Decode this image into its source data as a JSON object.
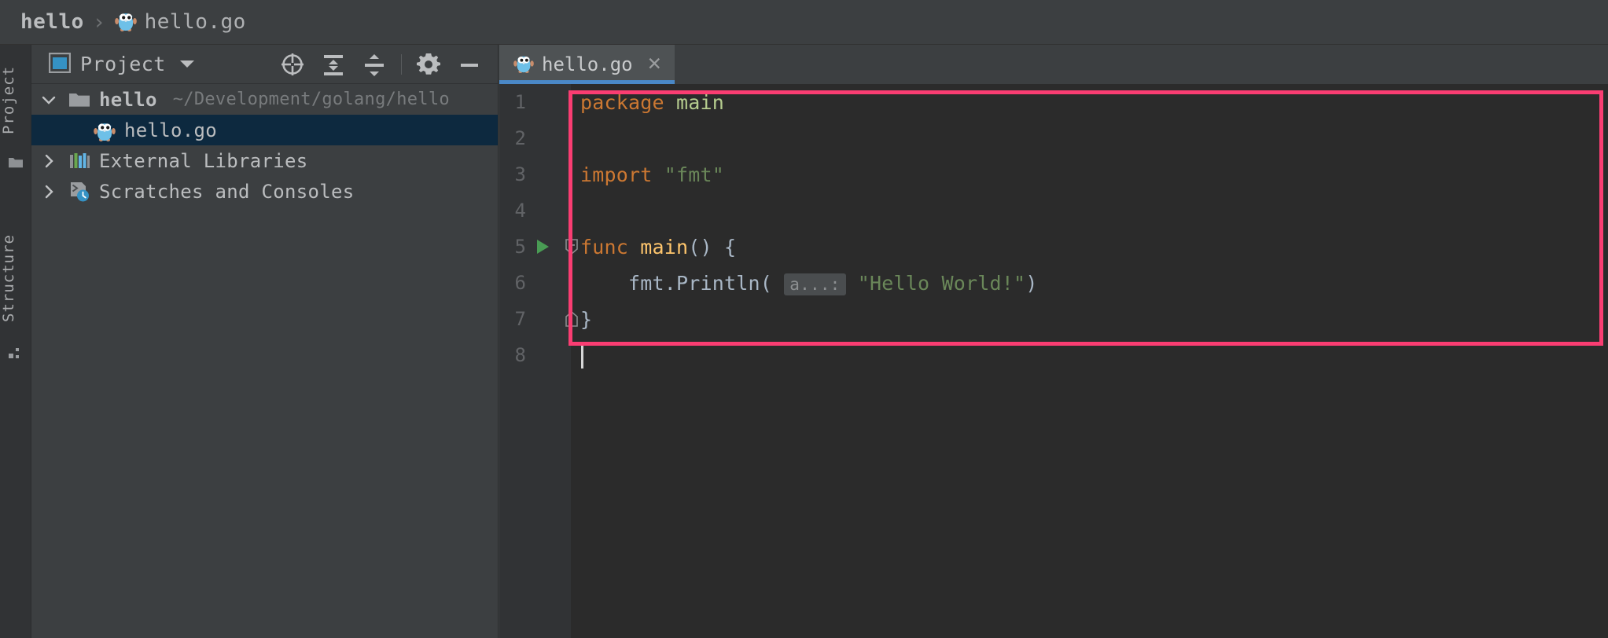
{
  "window": {
    "title": "GoLand - hello.go",
    "background": "#3c3f41",
    "editor_background": "#2b2b2b",
    "accent_blue": "#4a88c7",
    "highlight_border": "#fa3d72",
    "selection_blue": "#0d293f"
  },
  "breadcrumb": {
    "project_name": "hello",
    "separator": "›",
    "file_name": "hello.go",
    "file_icon": "go-gopher-icon"
  },
  "tool_strip": {
    "tabs": [
      {
        "label": "Project",
        "icon": "folder-icon"
      },
      {
        "label": "Structure",
        "icon": "structure-icon"
      }
    ]
  },
  "project_panel": {
    "title": "Project",
    "title_icon": "project-view-icon",
    "dropdown_icon": "chevron-down-icon",
    "toolbar": [
      {
        "name": "select-opened-file-button",
        "icon": "crosshair-target-icon"
      },
      {
        "name": "expand-all-button",
        "icon": "expand-all-icon"
      },
      {
        "name": "collapse-all-button",
        "icon": "collapse-all-icon"
      },
      {
        "name": "settings-button",
        "icon": "gear-icon"
      },
      {
        "name": "hide-panel-button",
        "icon": "minus-icon"
      }
    ],
    "tree": [
      {
        "label": "hello",
        "path": "~/Development/golang/hello",
        "icon": "folder-icon",
        "arrow": "chevron-down-icon",
        "expanded": true,
        "bold": true,
        "selected": false,
        "indent": 0
      },
      {
        "label": "hello.go",
        "path": "",
        "icon": "go-gopher-icon",
        "arrow": "",
        "expanded": false,
        "bold": false,
        "selected": true,
        "indent": 1
      },
      {
        "label": "External Libraries",
        "path": "",
        "icon": "libraries-icon",
        "arrow": "chevron-right-icon",
        "expanded": false,
        "bold": false,
        "selected": false,
        "indent": 0
      },
      {
        "label": "Scratches and Consoles",
        "path": "",
        "icon": "scratches-clock-icon",
        "arrow": "chevron-right-icon",
        "expanded": false,
        "bold": false,
        "selected": false,
        "indent": 0
      }
    ]
  },
  "editor": {
    "tab": {
      "label": "hello.go",
      "icon": "go-gopher-icon",
      "close_icon": "close-icon",
      "active": true
    },
    "lines": [
      {
        "number": "1",
        "run_marker": false,
        "fold_marker": "",
        "tokens": [
          {
            "text": "package",
            "style": "kw"
          },
          {
            "text": " ",
            "style": "plain"
          },
          {
            "text": "main",
            "style": "ident-green"
          }
        ]
      },
      {
        "number": "2",
        "run_marker": false,
        "fold_marker": "",
        "tokens": []
      },
      {
        "number": "3",
        "run_marker": false,
        "fold_marker": "",
        "tokens": [
          {
            "text": "import",
            "style": "kw"
          },
          {
            "text": " ",
            "style": "plain"
          },
          {
            "text": "\"fmt\"",
            "style": "str"
          }
        ]
      },
      {
        "number": "4",
        "run_marker": false,
        "fold_marker": "",
        "tokens": []
      },
      {
        "number": "5",
        "run_marker": true,
        "fold_marker": "fold-collapse-icon",
        "tokens": [
          {
            "text": "func",
            "style": "kw"
          },
          {
            "text": " ",
            "style": "plain"
          },
          {
            "text": "main",
            "style": "fn"
          },
          {
            "text": "() {",
            "style": "punct"
          }
        ]
      },
      {
        "number": "6",
        "run_marker": false,
        "fold_marker": "",
        "tokens": [
          {
            "text": "    fmt.Println(",
            "style": "plain"
          },
          {
            "text": " a...: ",
            "style": "hint"
          },
          {
            "text": "\"Hello World!\"",
            "style": "str"
          },
          {
            "text": ")",
            "style": "plain"
          }
        ]
      },
      {
        "number": "7",
        "run_marker": false,
        "fold_marker": "fold-end-icon",
        "tokens": [
          {
            "text": "}",
            "style": "punct"
          }
        ]
      },
      {
        "number": "8",
        "run_marker": false,
        "fold_marker": "",
        "tokens": [],
        "caret": true
      }
    ],
    "parameter_hint": "a...:",
    "highlight_annotation": {
      "shape": "rectangle",
      "color": "#fa3d72",
      "covers_lines": "1-7"
    }
  }
}
